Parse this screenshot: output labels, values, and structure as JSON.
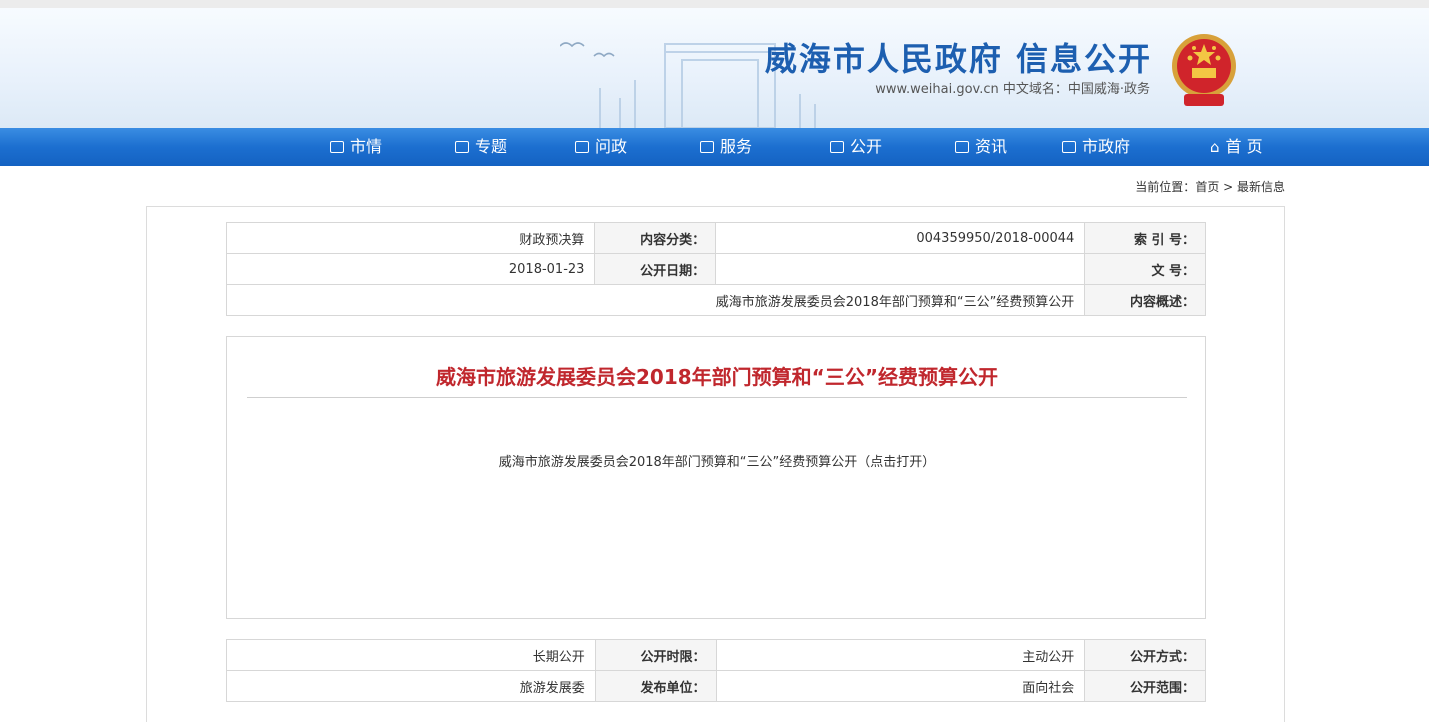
{
  "header": {
    "site_title": "威海市人民政府  信息公开",
    "site_subtitle": "www.weihai.gov.cn  中文域名：中国威海·政务",
    "emblem_icon": "national-emblem-icon"
  },
  "nav": {
    "items": [
      {
        "label": "首 页",
        "icon": "home-icon"
      },
      {
        "label": "市政府",
        "icon": "building-icon"
      },
      {
        "label": "资讯",
        "icon": "news-icon"
      },
      {
        "label": "公开",
        "icon": "book-icon"
      },
      {
        "label": "服务",
        "icon": "service-icon"
      },
      {
        "label": "问政",
        "icon": "chat-icon"
      },
      {
        "label": "专题",
        "icon": "topic-icon"
      },
      {
        "label": "市情",
        "icon": "city-info-icon"
      }
    ],
    "colors": {
      "bar": "#1c6fd0",
      "text": "#ffffff"
    }
  },
  "breadcrumb": {
    "label": "当前位置：",
    "path": "首页 > 最新信息"
  },
  "meta_top": {
    "index_label": "索 引 号：",
    "index_value": "004359950/2018-00044",
    "category_label": "内容分类：",
    "category_value": "财政预决算",
    "doc_no_label": "文 号：",
    "doc_no_value": "",
    "date_label": "公开日期：",
    "date_value": "2018-01-23",
    "summary_label": "内容概述：",
    "summary_value": "威海市旅游发展委员会2018年部门预算和“三公”经费预算公开"
  },
  "article": {
    "title": "威海市旅游发展委员会2018年部门预算和“三公”经费预算公开",
    "link_text": "威海市旅游发展委员会2018年部门预算和“三公”经费预算公开（点击打开）",
    "title_color": "#c0272d"
  },
  "meta_bottom": {
    "mode_label": "公开方式：",
    "mode_value": "主动公开",
    "period_label": "公开时限：",
    "period_value": "长期公开",
    "scope_label": "公开范围：",
    "scope_value": "面向社会",
    "publisher_label": "发布单位：",
    "publisher_value": "旅游发展委"
  }
}
